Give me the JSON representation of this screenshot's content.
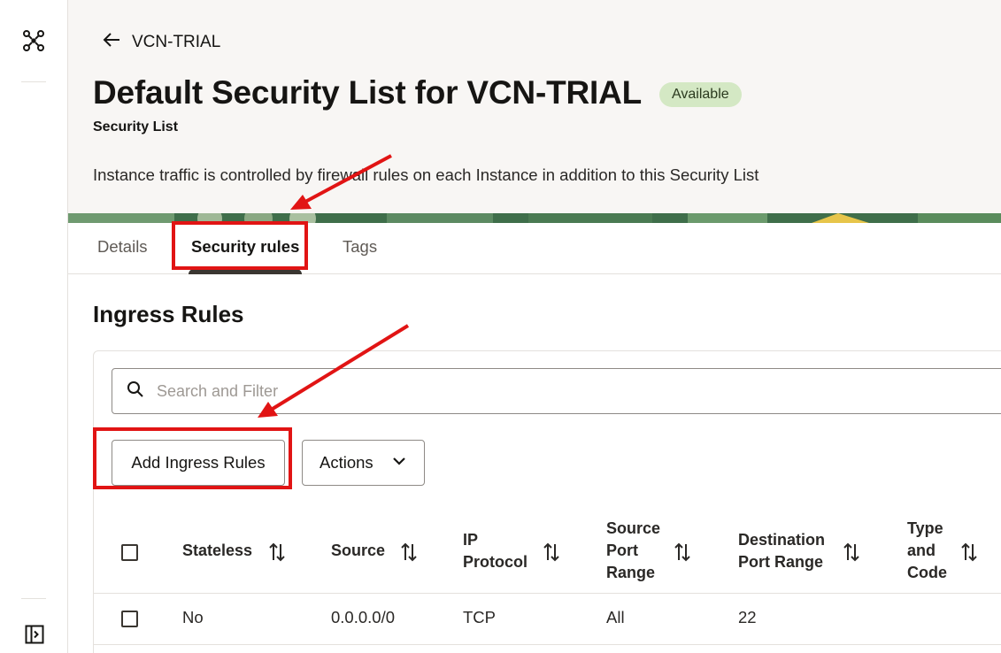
{
  "nav": {
    "back_label": "VCN-TRIAL",
    "top_icon": "network-icon",
    "bottom_icon": "expand-sidebar-icon"
  },
  "header": {
    "title": "Default Security List for VCN-TRIAL",
    "status_badge": "Available",
    "subtitle": "Security List",
    "description": "Instance traffic is controlled by firewall rules on each Instance in addition to this Security List"
  },
  "tabs": [
    {
      "label": "Details",
      "active": false
    },
    {
      "label": "Security rules",
      "active": true
    },
    {
      "label": "Tags",
      "active": false
    }
  ],
  "ingress": {
    "title": "Ingress Rules",
    "search_placeholder": "Search and Filter",
    "add_button": "Add Ingress Rules",
    "actions_button": "Actions",
    "columns": [
      [
        "Stateless"
      ],
      [
        "Source"
      ],
      [
        "IP",
        "Protocol"
      ],
      [
        "Source",
        "Port",
        "Range"
      ],
      [
        "Destination",
        "Port Range"
      ],
      [
        "Type",
        "and",
        "Code"
      ]
    ],
    "rows": [
      {
        "stateless": "No",
        "source": "0.0.0.0/0",
        "protocol": "TCP",
        "source_port": "All",
        "dest_port": "22"
      }
    ]
  },
  "colors": {
    "annotation": "#e11414",
    "badge_bg": "#d4e8c4",
    "header_bg": "#f8f6f4"
  }
}
